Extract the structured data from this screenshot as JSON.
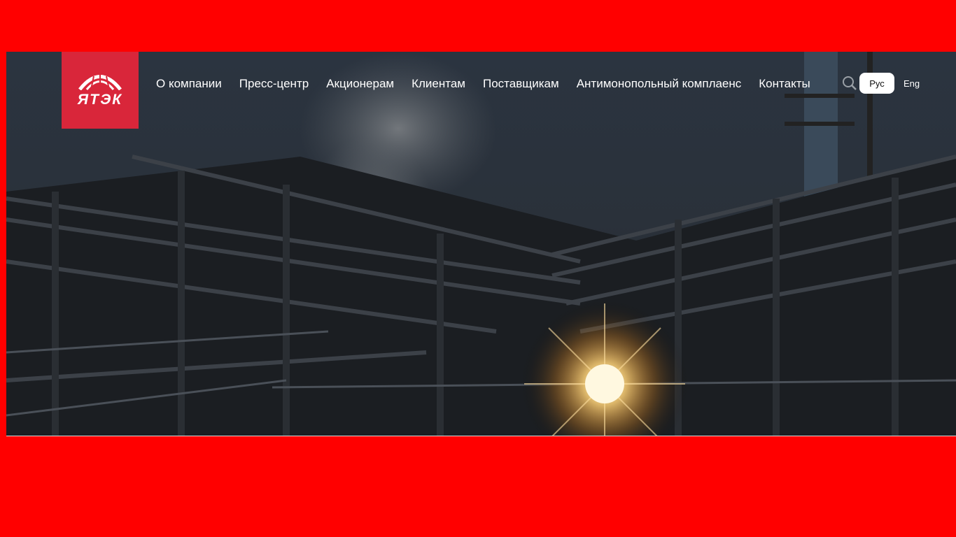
{
  "brand": {
    "logo_text": "ЯТЭК",
    "color": "#d9263a"
  },
  "page_background": "#ff0000",
  "nav": {
    "items": [
      {
        "label": "О компании"
      },
      {
        "label": "Пресс-центр"
      },
      {
        "label": "Акционерам"
      },
      {
        "label": "Клиентам"
      },
      {
        "label": "Поставщикам"
      },
      {
        "label": "Антимонопольный комплаенс"
      },
      {
        "label": "Контакты"
      }
    ]
  },
  "header": {
    "search_icon": "search-icon",
    "languages": {
      "active": "Рус",
      "other": "Eng"
    }
  },
  "hero": {
    "image": "industrial-plant-sunset-photo"
  }
}
